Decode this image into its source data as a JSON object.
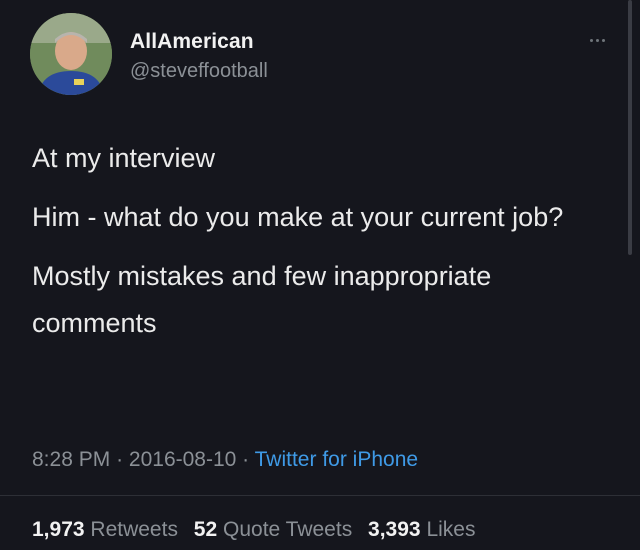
{
  "user": {
    "display_name": "AllAmerican",
    "handle": "@steveffootball",
    "avatar_icon": "profile-photo"
  },
  "tweet": {
    "lines": [
      "At my interview",
      "Him - what do you make at your current job?",
      "Mostly mistakes and few inappropriate comments"
    ]
  },
  "meta": {
    "time": "8:28 PM",
    "date": "2016-08-10",
    "separator": "·",
    "source": "Twitter for iPhone"
  },
  "stats": {
    "retweets_count": "1,973",
    "retweets_label": "Retweets",
    "quotes_count": "52",
    "quotes_label": "Quote Tweets",
    "likes_count": "3,393",
    "likes_label": "Likes"
  },
  "colors": {
    "background": "#15161d",
    "link": "#3f9ae6",
    "muted": "#8b9096"
  }
}
